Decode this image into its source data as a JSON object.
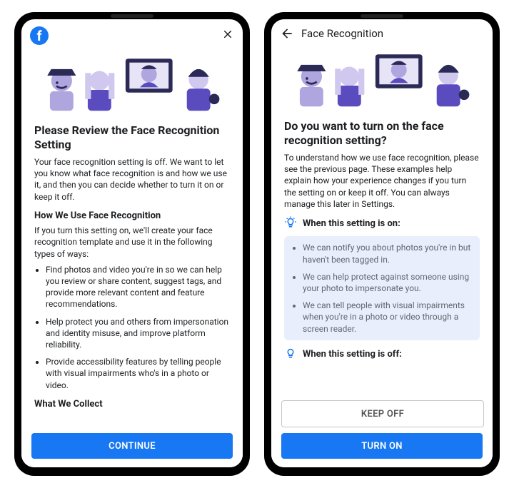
{
  "screen1": {
    "title": "Please Review the Face Recognition Setting",
    "intro": "Your face recognition setting is off. We want to let you know what face recognition is and how we use it, and then you can decide whether to turn it on or keep it off.",
    "section_heading": "How We Use Face Recognition",
    "section_intro": "If you turn this setting on, we'll create your face recognition template and use it in the following types of ways:",
    "bullets": [
      "Find photos and video you're in so we can help you review or share content, suggest tags, and provide more relevant content and feature recommendations.",
      "Help protect you and others from impersonation and identity misuse, and improve platform reliability.",
      "Provide accessibility features by telling people with visual impairments who's in a photo or video."
    ],
    "section2_heading": "What We Collect",
    "continue_label": "CONTINUE"
  },
  "screen2": {
    "header_title": "Face Recognition",
    "title": "Do you want to turn on the face recognition setting?",
    "intro": "To understand how we use face recognition, please see the previous page. These examples help explain how your experience changes if you turn the setting on or keep it off. You can always manage this later in Settings.",
    "on_heading": "When this setting is on:",
    "on_bullets": [
      "We can notify you about photos you're in but haven't been tagged in.",
      "We can help protect against someone using your photo to impersonate you.",
      "We can tell people with visual impairments when you're in a photo or video through a screen reader."
    ],
    "off_heading": "When this setting is off:",
    "keep_off_label": "KEEP OFF",
    "turn_on_label": "TURN ON"
  }
}
